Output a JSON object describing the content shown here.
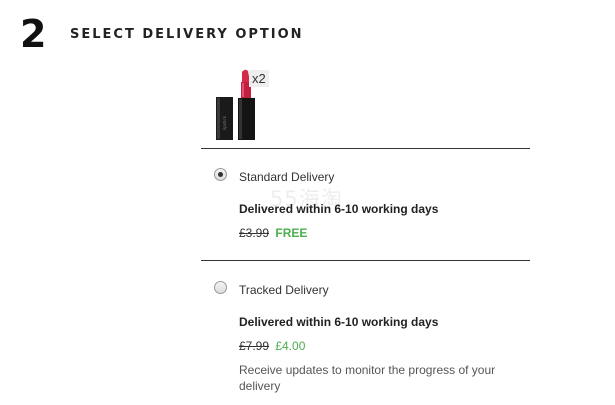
{
  "step": {
    "number": "2",
    "title": "SELECT DELIVERY OPTION"
  },
  "product": {
    "image": "lipstick-product-image",
    "quantity": "x2"
  },
  "delivery_options": [
    {
      "name": "Standard Delivery",
      "selected": true,
      "description": "Delivered within 6-10 working days",
      "old_price": "£3.99",
      "new_price": "FREE"
    },
    {
      "name": "Tracked Delivery",
      "selected": false,
      "description": "Delivered within 6-10 working days",
      "old_price": "£7.99",
      "new_price": "£4.00",
      "note": "Receive updates to monitor the progress of your delivery"
    }
  ],
  "colors": {
    "price_highlight": "#4caf50",
    "divider": "#333333"
  },
  "watermark": "55海淘"
}
